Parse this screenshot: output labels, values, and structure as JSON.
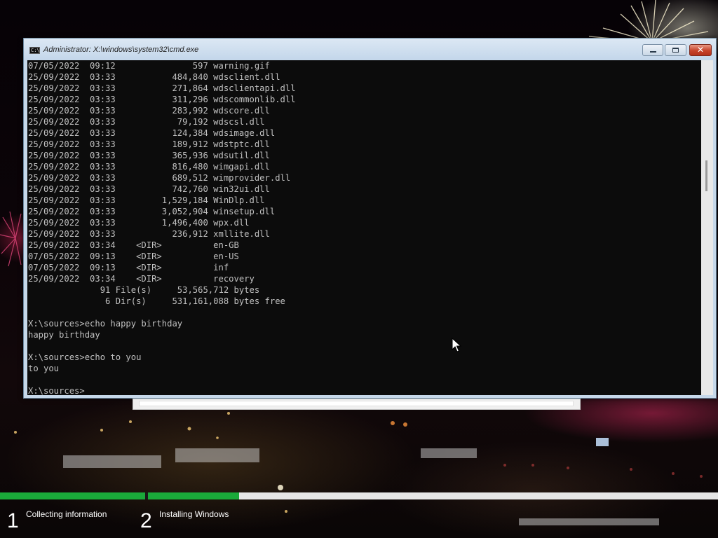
{
  "window": {
    "title": "Administrator: X:\\windows\\system32\\cmd.exe",
    "icon": "cmd-icon",
    "buttons": {
      "minimize": "minimize-icon",
      "maximize": "maximize-icon",
      "close": "close-icon",
      "close_glyph": "✕"
    }
  },
  "console": {
    "lines": [
      "07/05/2022  09:12               597 warning.gif",
      "25/09/2022  03:33           484,840 wdsclient.dll",
      "25/09/2022  03:33           271,864 wdsclientapi.dll",
      "25/09/2022  03:33           311,296 wdscommonlib.dll",
      "25/09/2022  03:33           283,992 wdscore.dll",
      "25/09/2022  03:33            79,192 wdscsl.dll",
      "25/09/2022  03:33           124,384 wdsimage.dll",
      "25/09/2022  03:33           189,912 wdstptc.dll",
      "25/09/2022  03:33           365,936 wdsutil.dll",
      "25/09/2022  03:33           816,480 wimgapi.dll",
      "25/09/2022  03:33           689,512 wimprovider.dll",
      "25/09/2022  03:33           742,760 win32ui.dll",
      "25/09/2022  03:33         1,529,184 WinDlp.dll",
      "25/09/2022  03:33         3,052,904 winsetup.dll",
      "25/09/2022  03:33         1,496,400 wpx.dll",
      "25/09/2022  03:33           236,912 xmllite.dll",
      "25/09/2022  03:34    <DIR>          en-GB",
      "07/05/2022  09:13    <DIR>          en-US",
      "07/05/2022  09:13    <DIR>          inf",
      "25/09/2022  03:34    <DIR>          recovery",
      "              91 File(s)     53,565,712 bytes",
      "               6 Dir(s)     531,161,088 bytes free",
      "",
      "X:\\sources>echo happy birthday",
      "happy birthday",
      "",
      "X:\\sources>echo to you",
      "to you",
      "",
      "X:\\sources>"
    ],
    "text_color": "#c0c0c0",
    "background": "#0c0c0c"
  },
  "setup": {
    "steps": [
      {
        "number": "1",
        "label": "Collecting information",
        "progress": 1.0
      },
      {
        "number": "2",
        "label": "Installing Windows",
        "progress": 0.16
      }
    ],
    "progress_color": "#1aaa3a"
  }
}
